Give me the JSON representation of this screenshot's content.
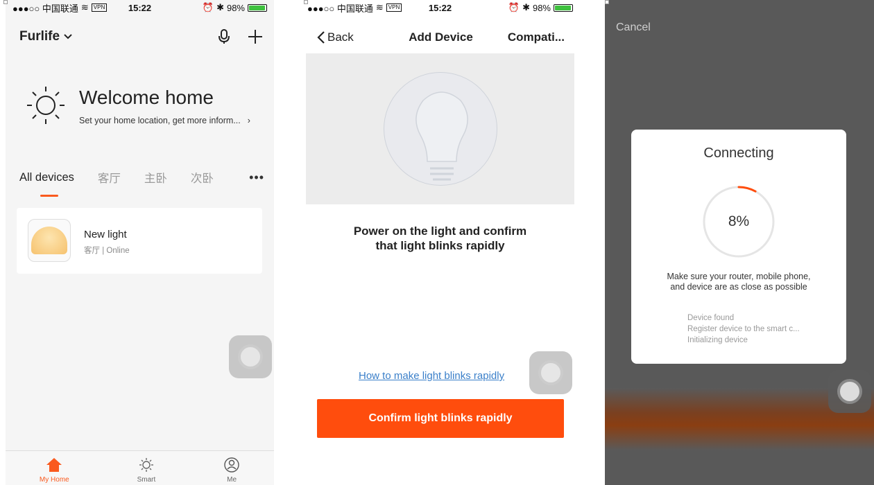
{
  "status_bar": {
    "carrier": "●●●○○ 中国联通",
    "vpn": "VPN",
    "time": "15:22",
    "battery": "98%"
  },
  "home": {
    "home_name": "Furlife",
    "welcome_title": "Welcome home",
    "welcome_sub": "Set your home location, get more inform...",
    "tabs": [
      "All devices",
      "客厅",
      "主卧",
      "次卧"
    ],
    "more": "•••",
    "device": {
      "name": "New light",
      "room": "客厅",
      "status": "Online"
    },
    "nav": [
      {
        "label": "My Home"
      },
      {
        "label": "Smart"
      },
      {
        "label": "Me"
      }
    ]
  },
  "add_device": {
    "back": "Back",
    "title": "Add Device",
    "compat": "Compati...",
    "instruction_line1": "Power on the light and confirm",
    "instruction_line2": "that light blinks  rapidly",
    "howto_link": "How to make light blinks rapidly",
    "confirm_button": "Confirm light blinks rapidly"
  },
  "connecting": {
    "cancel": "Cancel",
    "title": "Connecting",
    "progress": 8,
    "progress_label": "8%",
    "hint_line1": "Make sure your router, mobile phone,",
    "hint_line2": "and device are as close as possible",
    "steps": [
      "Device found",
      "Register device to the smart c...",
      "Initializing device"
    ]
  },
  "colors": {
    "accent": "#ff4d0d",
    "link": "#3a7fc9",
    "online_battery": "#3ec13e"
  }
}
